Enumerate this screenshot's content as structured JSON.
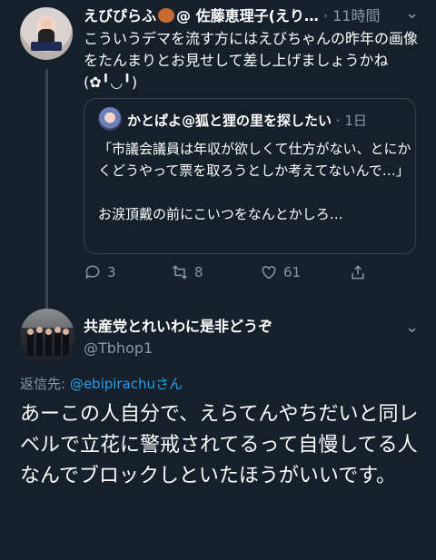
{
  "tweet1": {
    "display_name": "えびぴらふ",
    "name_suffix": "@ 佐藤恵理子(えり…",
    "time": "· 11時間",
    "text": "こういうデマを流す方にはえびちゃんの昨年の画像をたんまりとお見せして差し上げましょうかね(✿╹◡╹)",
    "quote": {
      "name": "かとぱよ@狐と狸の里を探したい",
      "time": "· 1日",
      "text": "「市議会議員は年収が欲しくて仕方がない、とにかくどうやって票を取ろうとしか考えてないんで…」\n\nお涙頂戴の前にこいつをなんとかしろ…"
    },
    "actions": {
      "replies": "3",
      "retweets": "8",
      "likes": "61"
    }
  },
  "tweet2": {
    "display_name": "共産党とれいわに是非どうぞ",
    "handle": "@Tbhop1",
    "reply_label": "返信先: ",
    "reply_mention": "@ebipirachu",
    "reply_suffix": "さん",
    "text": "あーこの人自分で、えらてんやちだいと同レベルで立花に警戒されてるって自慢してる人なんでブロックしといたほうがいいです。"
  }
}
